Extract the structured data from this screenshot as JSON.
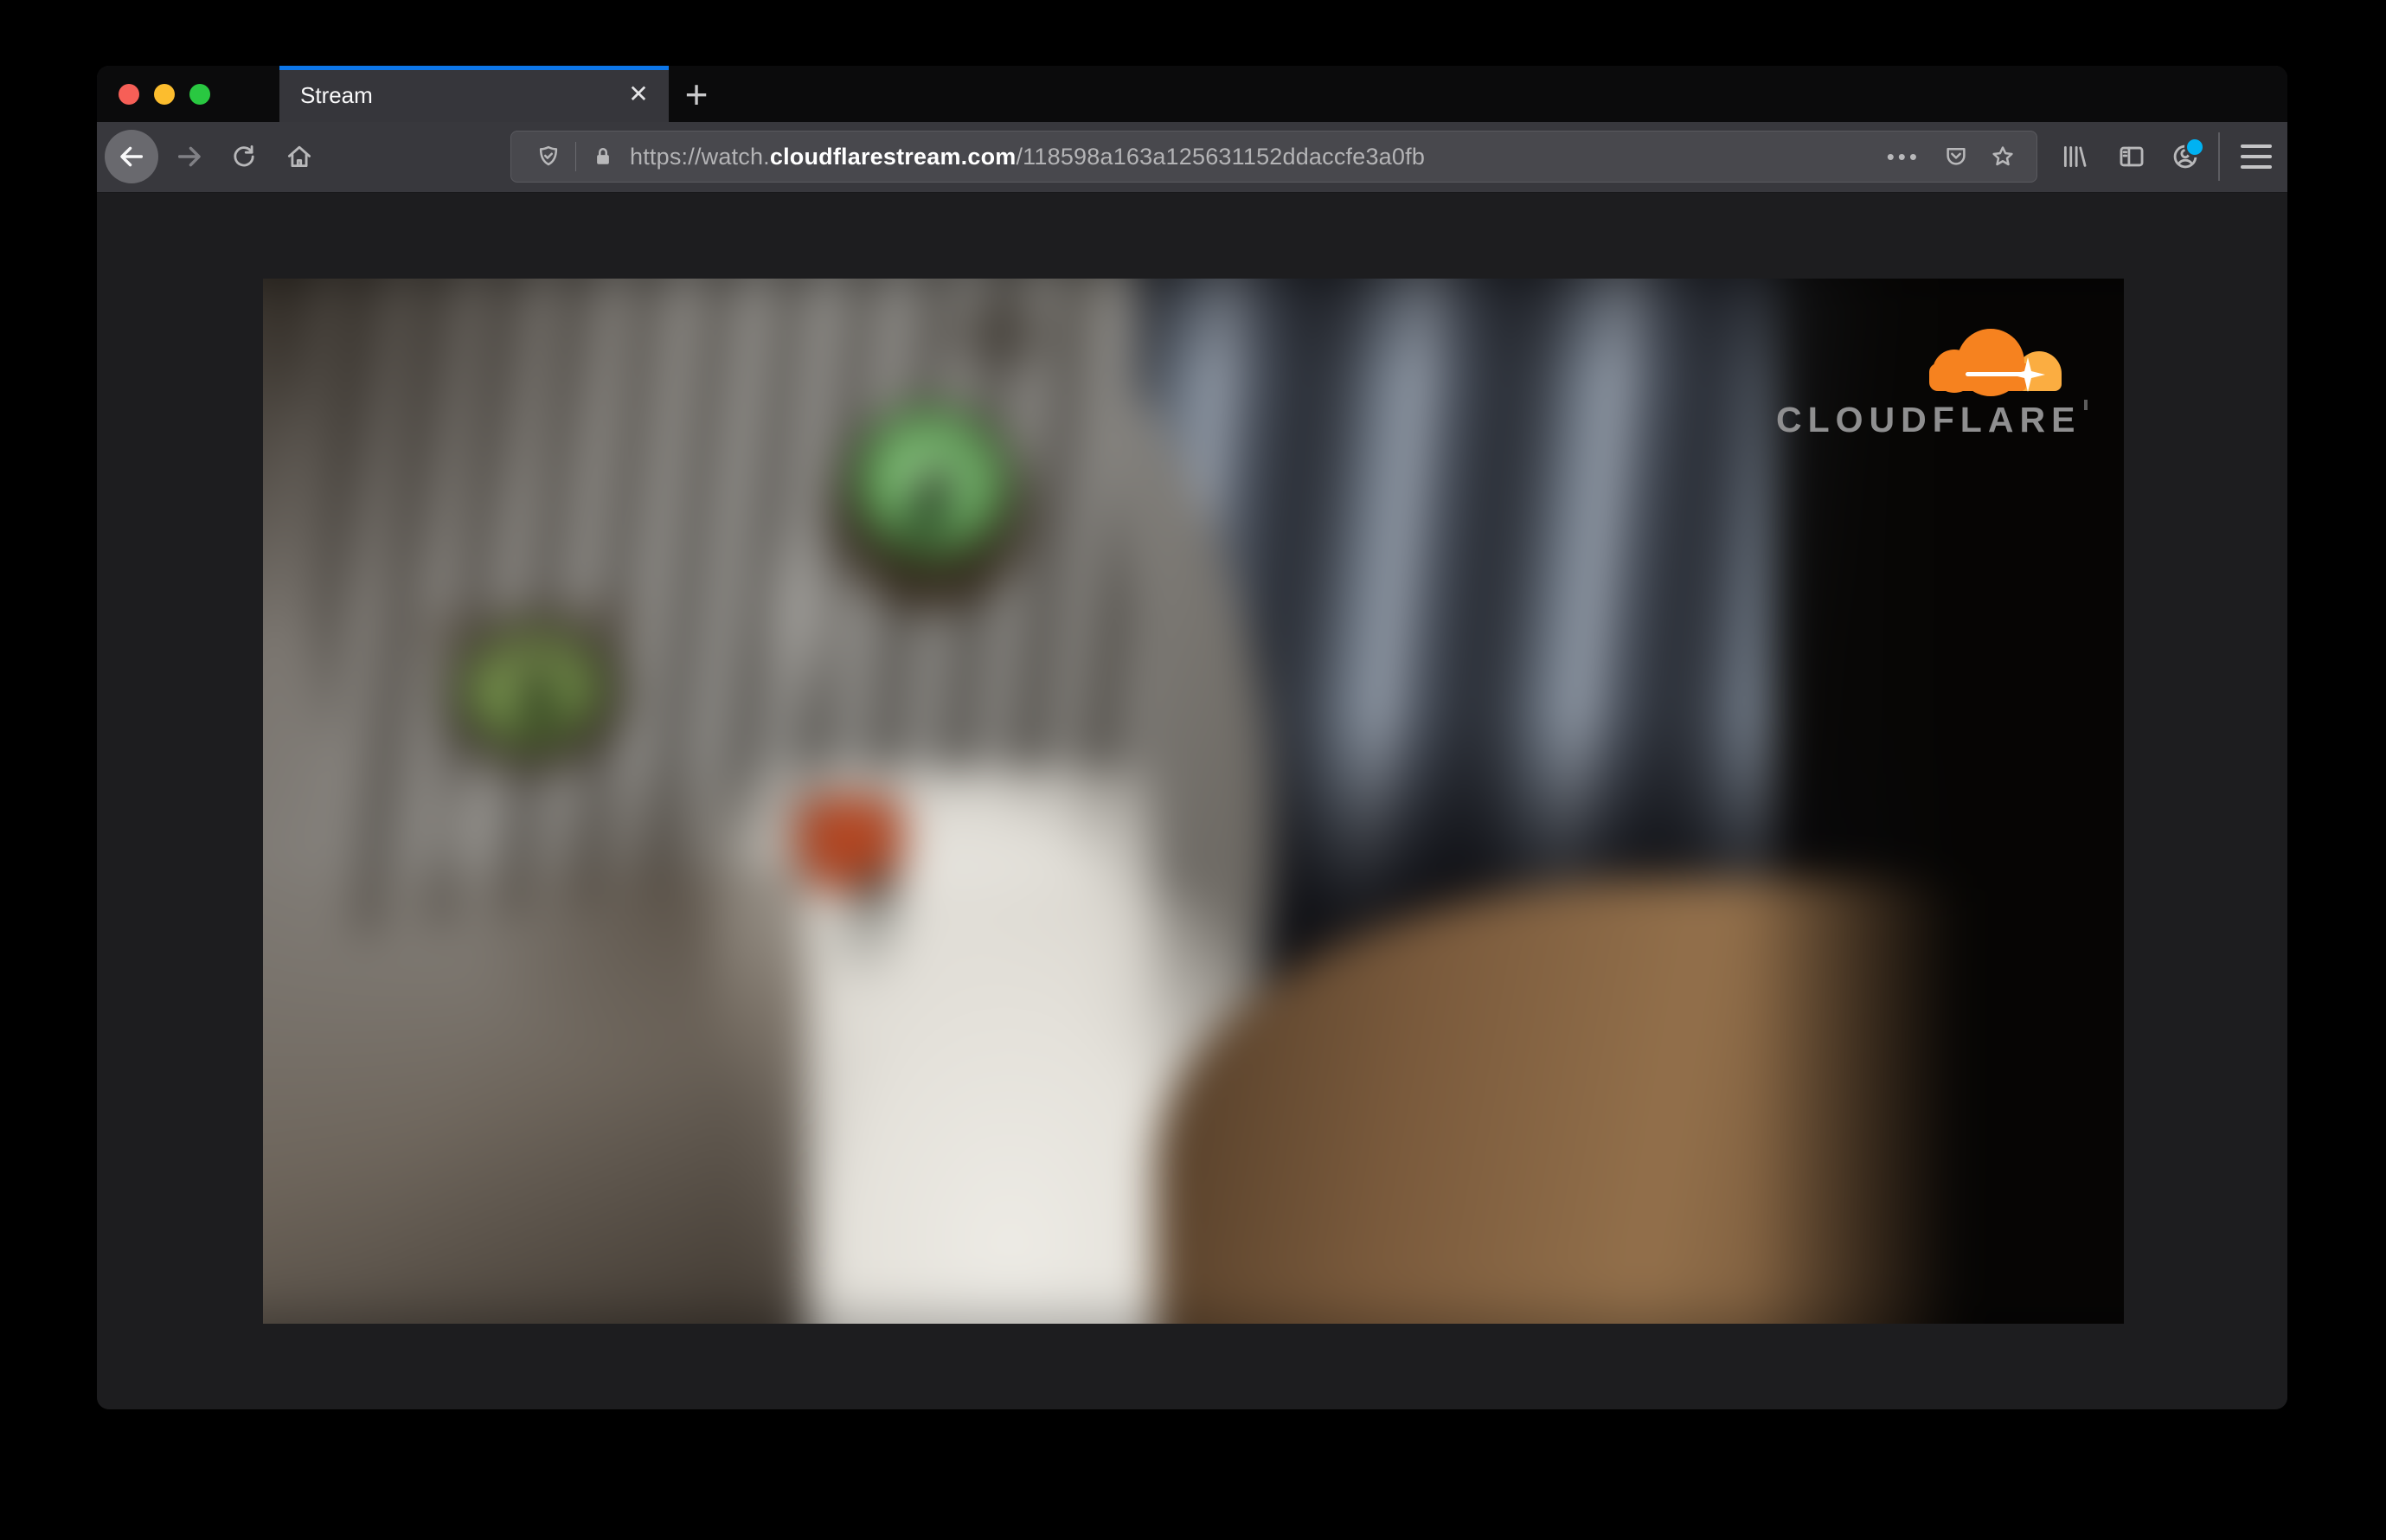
{
  "browser": {
    "traffic_lights": {
      "close": "red",
      "minimize": "yellow",
      "zoom": "green"
    },
    "tab": {
      "title": "Stream",
      "close_glyph": "✕"
    },
    "new_tab_glyph": "+",
    "url_bar": {
      "scheme_and_subdomain": "https://watch.",
      "domain": "cloudflarestream.com",
      "path": "/118598a163a125631152ddaccfe3a0fb",
      "page_actions_glyph": "•••"
    }
  },
  "page": {
    "video_player": {
      "brand": "CLOUDFLARE"
    }
  },
  "colors": {
    "tab_accent_blue": "#0d76e8",
    "notification_dot_blue": "#00b2f2",
    "cloudflare_orange": "#f6821f",
    "cloudflare_orange_light": "#fbad41",
    "traffic_red": "#f65f57",
    "traffic_yellow": "#fcbd2e",
    "traffic_green": "#29c841",
    "toolbar_gray": "#38383d",
    "tabstrip_black": "#0b0b0c"
  }
}
